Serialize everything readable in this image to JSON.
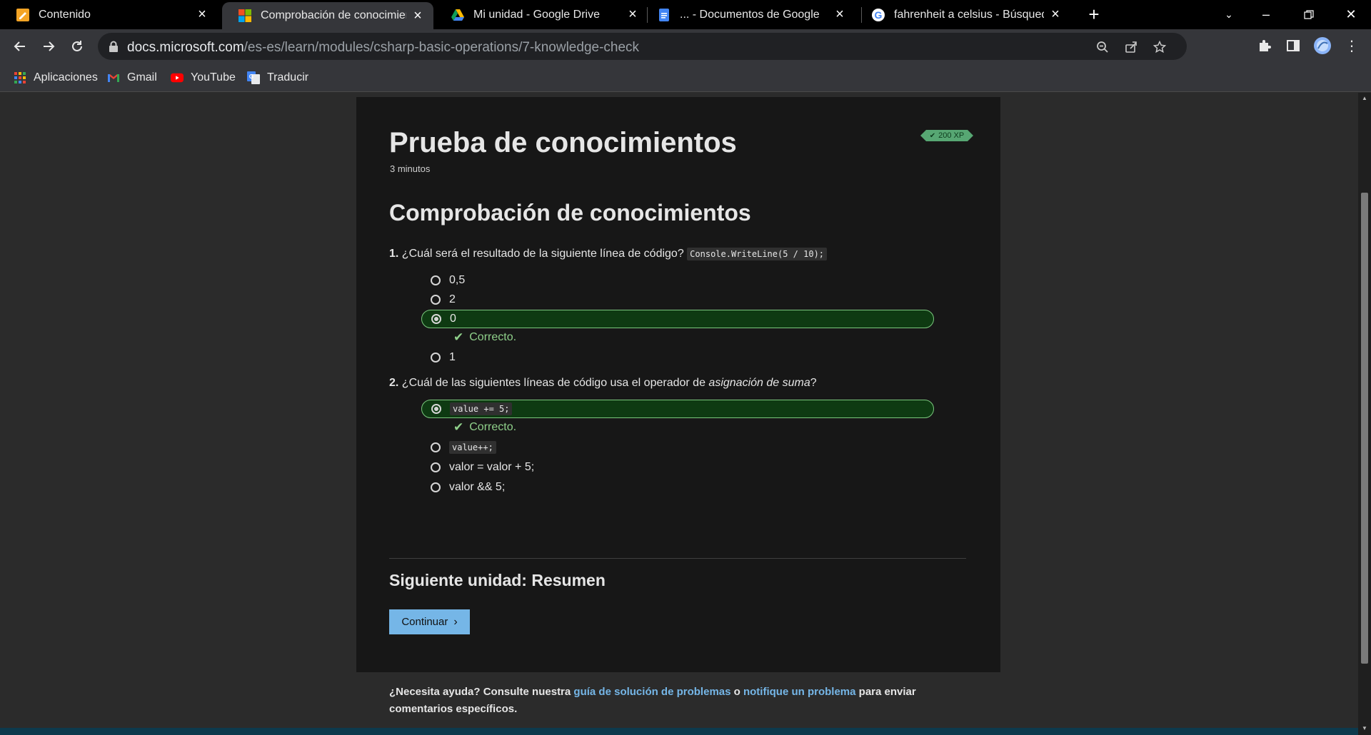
{
  "browser": {
    "tabs": [
      {
        "title": "Contenido",
        "icon": "notepad-icon"
      },
      {
        "title": "Comprobación de conocimientos",
        "icon": "microsoft-icon",
        "active": true
      },
      {
        "title": "Mi unidad - Google Drive",
        "icon": "google-drive-icon"
      },
      {
        "title": "... - Documentos de Google",
        "icon": "google-docs-icon"
      },
      {
        "title": "fahrenheit a celsius - Búsqueda de Google",
        "icon": "google-icon"
      }
    ],
    "url_host": "docs.microsoft.com",
    "url_path": "/es-es/learn/modules/csharp-basic-operations/7-knowledge-check",
    "bookmarks": [
      {
        "label": "Aplicaciones",
        "icon": "apps-grid-icon"
      },
      {
        "label": "Gmail",
        "icon": "gmail-icon"
      },
      {
        "label": "YouTube",
        "icon": "youtube-icon"
      },
      {
        "label": "Traducir",
        "icon": "translate-icon"
      }
    ]
  },
  "page": {
    "title": "Prueba de conocimientos",
    "duration": "3 minutos",
    "xp_badge": "200 XP",
    "section_title": "Comprobación de conocimientos",
    "questions": [
      {
        "number": "1.",
        "text": "¿Cuál será el resultado de la siguiente línea de código?",
        "code": "Console.WriteLine(5 / 10);",
        "options": [
          "0,5",
          "2",
          "0",
          "1"
        ],
        "selected_index": 2,
        "feedback": "Correcto."
      },
      {
        "number": "2.",
        "text_before": "¿Cuál de las siguientes líneas de código usa el operador de",
        "text_emph": "asignación de suma",
        "text_after": "?",
        "options": [
          "value += 5;",
          "value++;",
          "valor = valor + 5;",
          "valor && 5;"
        ],
        "selected_index": 0,
        "feedback": "Correcto."
      }
    ],
    "next_unit": "Siguiente unidad: Resumen",
    "continue_label": "Continuar",
    "help": {
      "prefix": "¿Necesita ayuda? Consulte nuestra",
      "link1": "guía de solución de problemas",
      "middle": "o",
      "link2": "notifique un problema",
      "suffix": "para enviar comentarios específicos."
    }
  },
  "colors": {
    "correct_fill": "#0e3a12",
    "correct_border": "#7ac77d",
    "link": "#75b6e7",
    "xp_badge": "#57a773"
  }
}
